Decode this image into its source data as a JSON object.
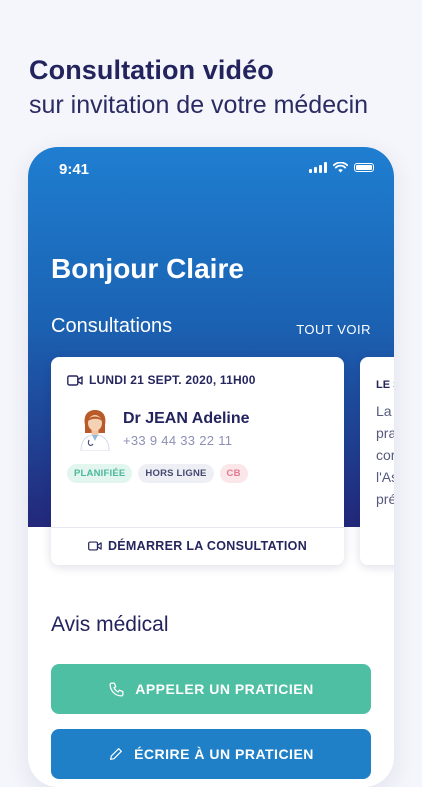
{
  "promo": {
    "title": "Consultation vidéo",
    "subtitle": "sur invitation de votre médecin"
  },
  "status_bar": {
    "time": "9:41",
    "icons": [
      "signal-icon",
      "wifi-icon",
      "battery-icon"
    ]
  },
  "home": {
    "greeting": "Bonjour Claire",
    "consultations_heading": "Consultations",
    "see_all_label": "TOUT VOIR"
  },
  "consultation_card": {
    "icon": "video-camera-icon",
    "date": "LUNDI 21 SEPT. 2020, 11H00",
    "doctor_name": "Dr JEAN Adeline",
    "doctor_phone": "+33 9 44 33 22 11",
    "tags": [
      "PLANIFIÉE",
      "HORS LIGNE",
      "CB"
    ],
    "action_label": "DÉMARRER LA CONSULTATION"
  },
  "next_card": {
    "heading": "LE S",
    "lines": [
      "La",
      "pra",
      "cor",
      "l'As",
      "pré"
    ]
  },
  "medical": {
    "heading": "Avis médical",
    "call_button": "APPELER UN PRATICIEN",
    "write_button": "ÉCRIRE À UN PRATICIEN"
  },
  "colors": {
    "hero_top": "#1f7ed0",
    "hero_bottom": "#23287a",
    "teal": "#4fbfa3",
    "blue": "#1f80c8",
    "navy": "#23235e"
  }
}
